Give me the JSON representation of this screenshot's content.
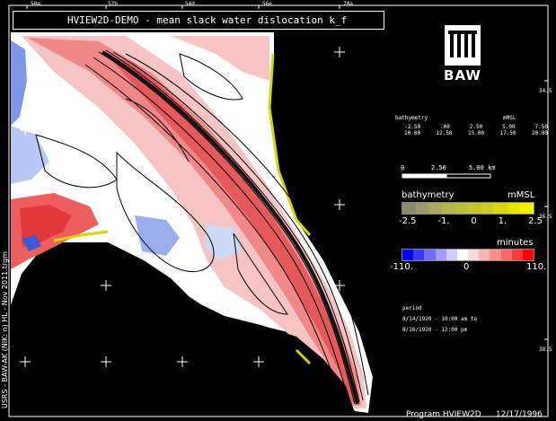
{
  "title": "HVIEW2D-DEMO - mean slack water dislocation k_f",
  "logo": {
    "text": "BAW",
    "icon": "baw-logo-icon"
  },
  "top_axis_labels": [
    "50a",
    "52b",
    "54d",
    "56e",
    "70a"
  ],
  "right_axis_labels": [
    "34.5",
    "36.5",
    "38.5"
  ],
  "left_vertical_text": "USRS - BAW-AK (NIK: n) HL - Nov 2011.trgm",
  "bathymetry_small_table": {
    "header": [
      "bathymetry",
      "mMSL"
    ],
    "row1": [
      "-2.50",
      ".00",
      "2.50",
      "5.00",
      "7.50"
    ],
    "row2": [
      "10.00",
      "12.50",
      "15.00",
      "17.50",
      "20.00"
    ]
  },
  "scale_bar": {
    "labels": [
      "0",
      "2.50",
      "5.00 km"
    ]
  },
  "bathymetry_legend": {
    "title": "bathymetry",
    "unit": "mMSL",
    "ticks": [
      "-2.5",
      "-1.",
      "0",
      "1.",
      "2.5"
    ],
    "colors": [
      "#8a8a70",
      "#9a9a6a",
      "#a8a860",
      "#b4b450",
      "#bcbc3c",
      "#c4c42c",
      "#cccc1c",
      "#d8d80c",
      "#e4e400",
      "#f0f000"
    ]
  },
  "minutes_legend": {
    "title": "minutes",
    "ticks": [
      "-110.",
      "0",
      "110."
    ],
    "colors": [
      "#0000ff",
      "#3a3aff",
      "#6f6fff",
      "#9f9fff",
      "#cfcfff",
      "#ffffff",
      "#ffdada",
      "#ffb4b4",
      "#ff8e8e",
      "#ff6868",
      "#ff3c3c",
      "#ff0000"
    ]
  },
  "period": {
    "label": "period",
    "line1": "8/14/1920 - 10:00 am to",
    "line2": "8/16/1920 - 12:00 pm"
  },
  "footer": {
    "program": "Program HVIEW2D",
    "date": "12/17/1996"
  },
  "colors": {
    "red_channel": "#f08888",
    "light_red": "#f7c4c4",
    "blue_area": "#7f97e8",
    "coast_yellow": "#d6d600"
  }
}
